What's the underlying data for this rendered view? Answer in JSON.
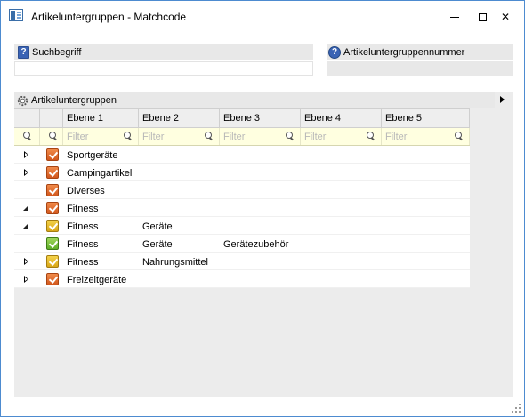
{
  "window": {
    "title": "Artikeluntergruppen - Matchcode"
  },
  "search": {
    "suchbegriff_label": "Suchbegriff",
    "suchbegriff_value": "",
    "nummer_label": "Artikeluntergruppennummer",
    "nummer_value": ""
  },
  "grid": {
    "title": "Artikeluntergruppen",
    "columns": [
      "Ebene 1",
      "Ebene 2",
      "Ebene 3",
      "Ebene 4",
      "Ebene 5"
    ],
    "filter_placeholder": "Filter",
    "rows": [
      {
        "expander": "collapsed",
        "status": "orange",
        "cells": [
          "Sportgeräte",
          "",
          "",
          "",
          ""
        ]
      },
      {
        "expander": "collapsed",
        "status": "orange",
        "cells": [
          "Campingartikel",
          "",
          "",
          "",
          ""
        ]
      },
      {
        "expander": "none",
        "status": "orange",
        "cells": [
          "Diverses",
          "",
          "",
          "",
          ""
        ]
      },
      {
        "expander": "expanded",
        "status": "orange",
        "cells": [
          "Fitness",
          "",
          "",
          "",
          ""
        ]
      },
      {
        "expander": "expanded",
        "status": "yellow",
        "cells": [
          "Fitness",
          "Geräte",
          "",
          "",
          ""
        ]
      },
      {
        "expander": "none",
        "status": "green",
        "cells": [
          "Fitness",
          "Geräte",
          "Gerätezubehör",
          "",
          ""
        ]
      },
      {
        "expander": "collapsed",
        "status": "yellow",
        "cells": [
          "Fitness",
          "Nahrungsmittel",
          "",
          "",
          ""
        ]
      },
      {
        "expander": "collapsed",
        "status": "orange",
        "cells": [
          "Freizeitgeräte",
          "",
          "",
          "",
          ""
        ]
      }
    ]
  },
  "colors": {
    "filter_row_bg": "#ffffe0",
    "status_orange": "#e06a2c",
    "status_yellow": "#e8bc2c",
    "status_green": "#7cc23e"
  }
}
